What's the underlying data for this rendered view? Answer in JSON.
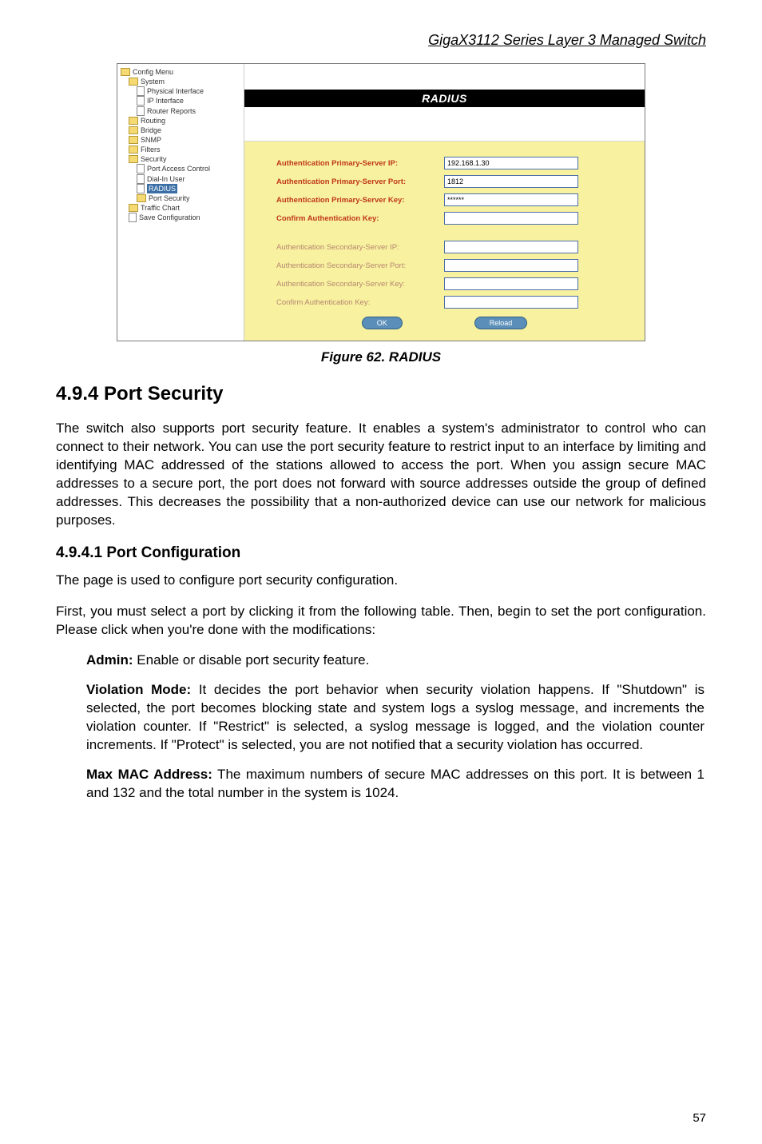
{
  "header": {
    "title": "GigaX3112 Series Layer 3 Managed Switch"
  },
  "tree": {
    "root": "Config Menu",
    "system": "System",
    "phys": "Physical Interface",
    "ipif": "IP Interface",
    "router_reports": "Router Reports",
    "routing": "Routing",
    "bridge": "Bridge",
    "snmp": "SNMP",
    "filters": "Filters",
    "security": "Security",
    "pac": "Port Access Control",
    "dial": "Dial-In User",
    "radius": "RADIUS",
    "portsec": "Port Security",
    "traffic": "Traffic Chart",
    "save": "Save Configuration"
  },
  "banner": "RADIUS",
  "form": {
    "prim_ip_label": "Authentication Primary-Server IP:",
    "prim_ip_value": "192.168.1.30",
    "prim_port_label": "Authentication Primary-Server Port:",
    "prim_port_value": "1812",
    "prim_key_label": "Authentication Primary-Server Key:",
    "prim_key_value": "******",
    "prim_confirm_label": "Confirm Authentication Key:",
    "sec_ip_label": "Authentication Secondary-Server IP:",
    "sec_port_label": "Authentication Secondary-Server Port:",
    "sec_key_label": "Authentication Secondary-Server Key:",
    "sec_confirm_label": "Confirm Authentication Key:",
    "ok_btn": "OK",
    "reload_btn": "Reload"
  },
  "caption": "Figure 62. RADIUS",
  "section_heading": "4.9.4    Port Security",
  "para1": "The switch also supports port security feature. It enables a system's administrator to control who can connect to their network. You can use the port security feature to restrict input to an interface by limiting and identifying MAC addressed of the stations allowed to access the port. When you assign secure MAC addresses to a secure port, the port does not forward with source addresses outside the group of defined addresses. This decreases the possibility that a non-authorized device can use our network for malicious purposes.",
  "subsection_heading": "4.9.4.1     Port Configuration",
  "para2": "The page is used to configure port security configuration.",
  "para3": "First, you must select a port by clicking it from the following table. Then, begin to set the port configuration. Please click  when you're done with the modifications:",
  "admin_bold": "Admin:",
  "admin_text": " Enable or disable port security feature.",
  "vio_bold": "Violation Mode:",
  "vio_text": " It decides the port behavior when security violation happens. If \"Shutdown\" is selected, the port becomes blocking state and system logs a syslog message, and increments the violation counter. If \"Restrict\" is selected, a syslog message is logged, and the violation counter increments. If \"Protect\" is selected, you are not notified that a security violation has occurred.",
  "mac_bold": "Max MAC Address:",
  "mac_text": " The maximum numbers of secure MAC addresses on this port. It is between 1 and 132 and the total number in the system is 1024.",
  "page_num": "57"
}
